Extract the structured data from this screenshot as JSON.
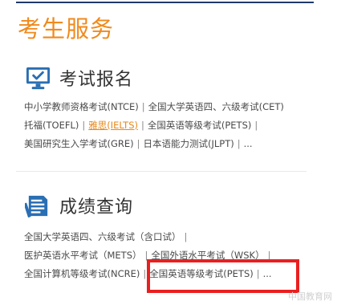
{
  "page": {
    "title": "考生服务"
  },
  "colors": {
    "accent": "#f08a1c",
    "icon_blue": "#2a6fb3",
    "highlight": "#ea1f1f"
  },
  "sections": [
    {
      "title": "考试报名",
      "icon": "monitor-check-icon",
      "rows": [
        {
          "links": [
            {
              "text": "中小学教师资格考试(NTCE)"
            },
            {
              "text": "全国大学英语四、六级考试(CET)"
            }
          ]
        },
        {
          "links": [
            {
              "text": "托福(TOEFL)"
            },
            {
              "text": "雅思(IELTS)"
            },
            {
              "text": "全国英语等级考试(PETS)"
            }
          ],
          "trailing_sep": true
        },
        {
          "links": [
            {
              "text": "美国研究生入学考试(GRE)"
            },
            {
              "text": "日本语能力测试(JLPT)"
            }
          ],
          "more": "..."
        }
      ]
    },
    {
      "title": "成绩查询",
      "icon": "document-search-icon",
      "rows": [
        {
          "links": [
            {
              "text": "全国大学英语四、六级考试（含口试）"
            }
          ],
          "trailing_sep": true
        },
        {
          "links": [
            {
              "text": "医护英语水平考试（METS）"
            },
            {
              "text": "全国外语水平考试（WSK）"
            }
          ],
          "trailing_sep": true
        },
        {
          "links": [
            {
              "text": "全国计算机等级考试(NCRE)"
            },
            {
              "text": "全国英语等级考试(PETS)"
            }
          ],
          "more": "..."
        }
      ]
    }
  ],
  "watermark": "中国教育网"
}
